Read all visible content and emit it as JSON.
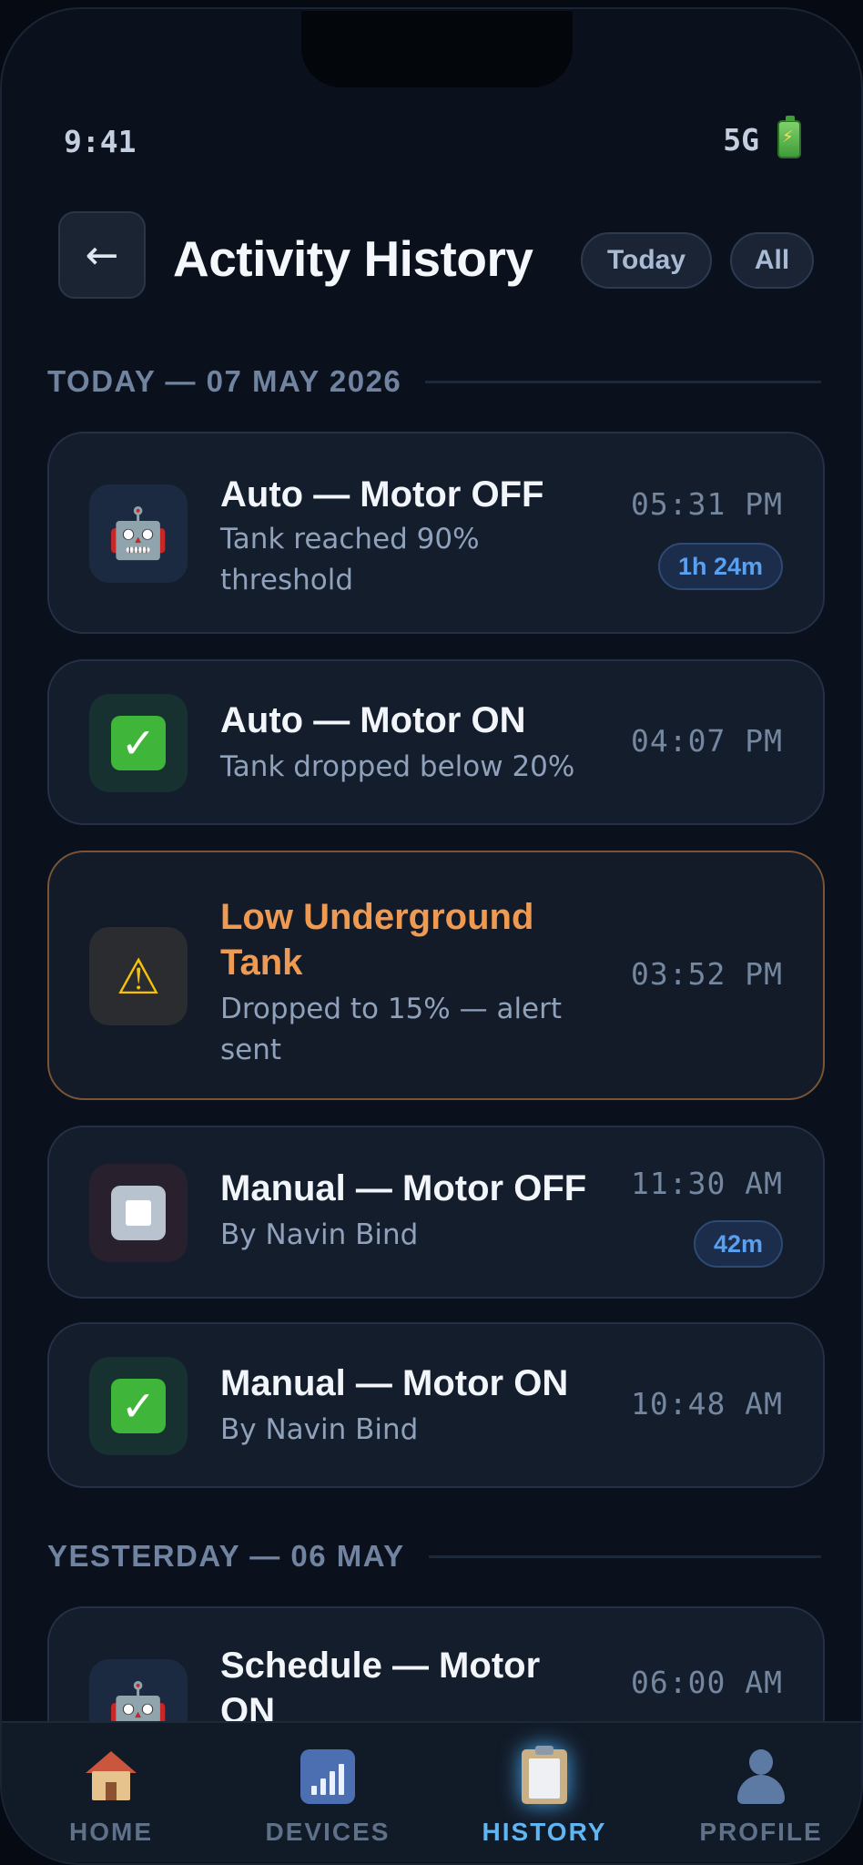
{
  "status_bar": {
    "time": "9:41",
    "network": "5G"
  },
  "header": {
    "back_label": "←",
    "title": "Activity History",
    "filters": [
      "Today",
      "All"
    ]
  },
  "sections": [
    {
      "label": "TODAY — 07 MAY 2026"
    },
    {
      "label": "YESTERDAY — 06 MAY"
    }
  ],
  "events": [
    {
      "icon": "robot-icon",
      "title": "Auto — Motor OFF",
      "subtitle": "Tank reached 90% threshold",
      "time": "05:31 PM",
      "duration": "1h 24m"
    },
    {
      "icon": "check-icon",
      "title": "Auto — Motor ON",
      "subtitle": "Tank dropped below 20%",
      "time": "04:07 PM"
    },
    {
      "icon": "warning-icon",
      "title": "Low Underground Tank",
      "subtitle": "Dropped to 15% — alert sent",
      "time": "03:52 PM",
      "status_color": "#ee9a52"
    },
    {
      "icon": "stop-icon",
      "title": "Manual — Motor OFF",
      "subtitle": "By Navin Bind",
      "time": "11:30 AM",
      "duration": "42m"
    },
    {
      "icon": "check-icon",
      "title": "Manual — Motor ON",
      "subtitle": "By Navin Bind",
      "time": "10:48 AM"
    },
    {
      "icon": "robot-icon",
      "title": "Schedule — Motor ON",
      "time": "06:00 AM"
    }
  ],
  "bottom_nav": [
    {
      "label": "HOME",
      "icon": "home-icon"
    },
    {
      "label": "DEVICES",
      "icon": "devices-icon"
    },
    {
      "label": "HISTORY",
      "icon": "history-icon",
      "active": true
    },
    {
      "label": "PROFILE",
      "icon": "profile-icon"
    }
  ],
  "colors": {
    "accent": "#5fb6f2",
    "warning": "#ee9a52",
    "badge": "#5aa0f0"
  }
}
